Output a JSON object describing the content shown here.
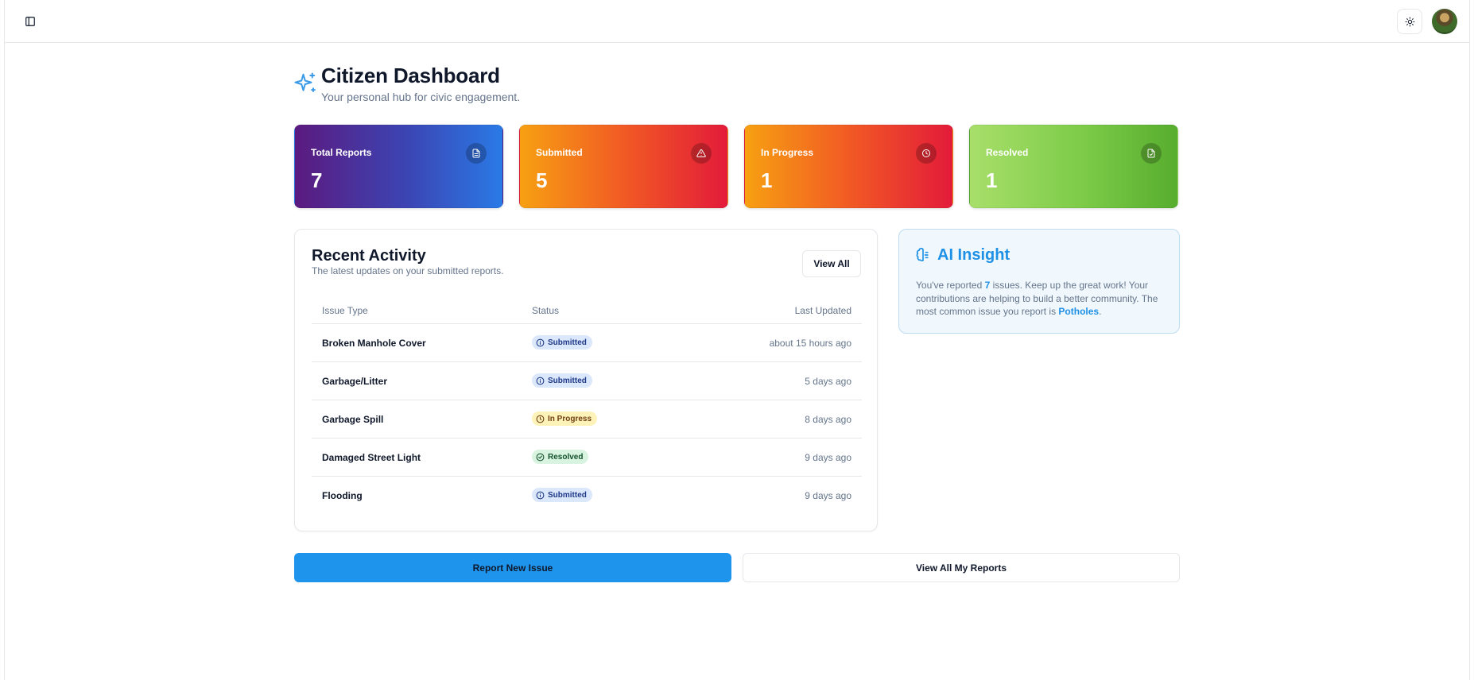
{
  "header": {
    "sidebar_toggle_icon": "panel-left-icon",
    "theme_icon": "sun-icon",
    "avatar_icon": "user-avatar"
  },
  "page": {
    "icon": "sparkles-icon",
    "title": "Citizen Dashboard",
    "subtitle": "Your personal hub for civic engagement."
  },
  "stats": [
    {
      "label": "Total Reports",
      "value": "7",
      "icon": "file-text-icon",
      "colors": [
        "#5b1a7f",
        "#2a7ae6"
      ]
    },
    {
      "label": "Submitted",
      "value": "5",
      "icon": "alert-triangle-icon",
      "colors": [
        "#f7a012",
        "#e31b3a"
      ]
    },
    {
      "label": "In Progress",
      "value": "1",
      "icon": "clock-icon",
      "colors": [
        "#f7a012",
        "#e31b3a"
      ]
    },
    {
      "label": "Resolved",
      "value": "1",
      "icon": "file-check-icon",
      "colors": [
        "#a8df6a",
        "#57ad2e"
      ]
    }
  ],
  "activity": {
    "title": "Recent Activity",
    "subtitle": "The latest updates on your submitted reports.",
    "view_all_label": "View All",
    "columns": [
      "Issue Type",
      "Status",
      "Last Updated"
    ],
    "rows": [
      {
        "type": "Broken Manhole Cover",
        "status": "Submitted",
        "updated": "about 15 hours ago"
      },
      {
        "type": "Garbage/Litter",
        "status": "Submitted",
        "updated": "5 days ago"
      },
      {
        "type": "Garbage Spill",
        "status": "In Progress",
        "updated": "8 days ago"
      },
      {
        "type": "Damaged Street Light",
        "status": "Resolved",
        "updated": "9 days ago"
      },
      {
        "type": "Flooding",
        "status": "Submitted",
        "updated": "9 days ago"
      }
    ]
  },
  "insight": {
    "icon": "brain-icon",
    "title": "AI Insight",
    "text_1": "You've reported ",
    "count": "7",
    "text_2": " issues. Keep up the great work! Your contributions are helping to build a better community. The most common issue you report is ",
    "common_issue": "Potholes",
    "text_3": ".",
    "accent": "#1e90e6"
  },
  "actions": {
    "report_label": "Report New Issue",
    "view_reports_label": "View All My Reports"
  },
  "colors": {
    "primary": "#1e94ec",
    "badge_submitted": "#dbe7fb",
    "badge_progress": "#fdf2b8",
    "badge_resolved": "#d8f3df"
  }
}
